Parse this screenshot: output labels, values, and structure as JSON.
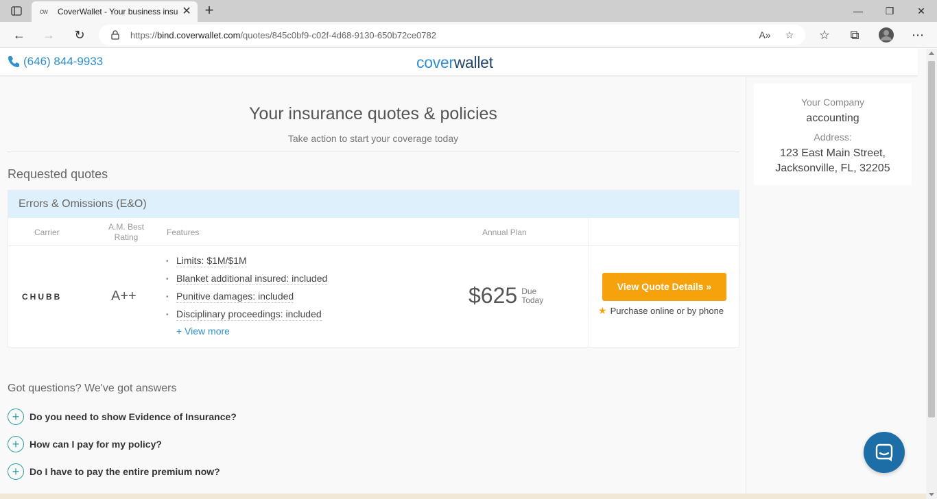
{
  "browser": {
    "tab": {
      "favicon_text": "cw",
      "title": "CoverWallet - Your business insu"
    },
    "url": {
      "prefix": "https://",
      "host": "bind.coverwallet.com",
      "path": "/quotes/845c0bf9-c02f-4d68-9130-650b72ce0782"
    },
    "icons": [
      "tab-actions-icon",
      "close-icon",
      "new-tab-icon",
      "minimize-icon",
      "restore-icon",
      "window-close-icon",
      "back-icon",
      "forward-icon",
      "refresh-icon",
      "lock-icon",
      "read-aloud-icon",
      "add-favorite-icon",
      "favorites-icon",
      "collections-icon",
      "profile-icon",
      "more-icon"
    ]
  },
  "header": {
    "phone": "(646) 844-9933",
    "logo_part1": "cover",
    "logo_part2": "wallet"
  },
  "main": {
    "title": "Your insurance quotes & policies",
    "subtitle": "Take action to start your coverage today",
    "section_title": "Requested quotes",
    "quote": {
      "product": "Errors & Omissions (E&O)",
      "columns": {
        "carrier": "Carrier",
        "rating_line1": "A.M. Best",
        "rating_line2": "Rating",
        "features": "Features",
        "annual": "Annual Plan"
      },
      "carrier": "CHUBB",
      "rating": "A++",
      "features": [
        "Limits: $1M/$1M",
        "Blanket additional insured: included",
        "Punitive damages: included",
        "Disciplinary proceedings: included"
      ],
      "view_more": "+ View more",
      "price": "$625",
      "due_line1": "Due",
      "due_line2": "Today",
      "cta": "View Quote Details »",
      "cta_note": "Purchase online or by phone"
    },
    "faq": {
      "title": "Got questions? We've got answers",
      "items": [
        "Do you need to show Evidence of Insurance?",
        "How can I pay for my policy?",
        "Do I have to pay the entire premium now?"
      ]
    }
  },
  "sidebar": {
    "company_label": "Your Company",
    "company_name": "accounting",
    "address_label": "Address:",
    "address_line1": "123 East Main Street,",
    "address_line2": "Jacksonville, FL, 32205"
  },
  "colors": {
    "brand_blue": "#2f8fcf",
    "brand_navy": "#254a6d",
    "cta_orange": "#f5a20c",
    "header_band": "#ddf0fc",
    "faq_teal": "#2aa2a0",
    "chat_blue": "#1d6ea6"
  }
}
